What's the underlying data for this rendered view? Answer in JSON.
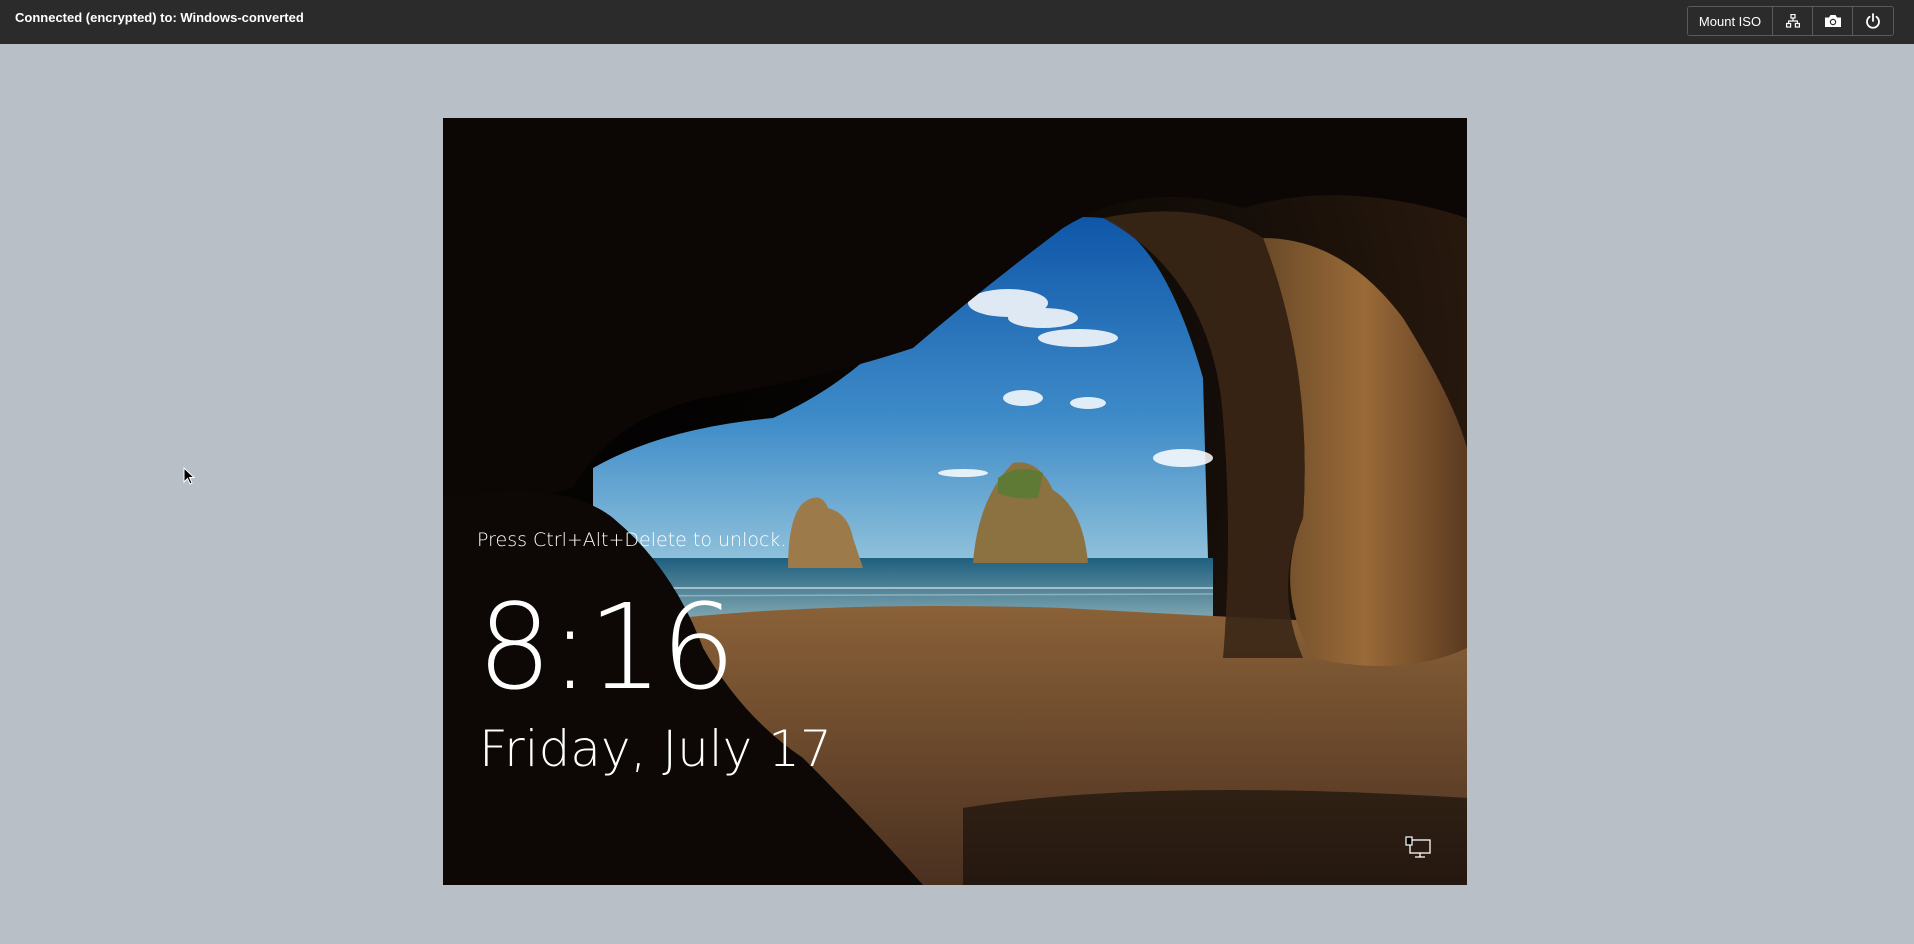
{
  "topbar": {
    "connection_title": "Connected (encrypted) to: Windows-converted",
    "buttons": {
      "mount_iso_label": "Mount ISO",
      "network_icon": "network-icon",
      "screenshot_icon": "camera-icon",
      "power_icon": "power-icon"
    }
  },
  "vm_screen": {
    "lock_message": "Press Ctrl+Alt+Delete to unlock.",
    "time": "8:16",
    "date": "Friday, July 17",
    "corner_icon": "network-status-icon"
  },
  "colors": {
    "topbar_bg": "#2b2b2b",
    "page_bg": "#b9bfc6",
    "text": "#ffffff"
  }
}
